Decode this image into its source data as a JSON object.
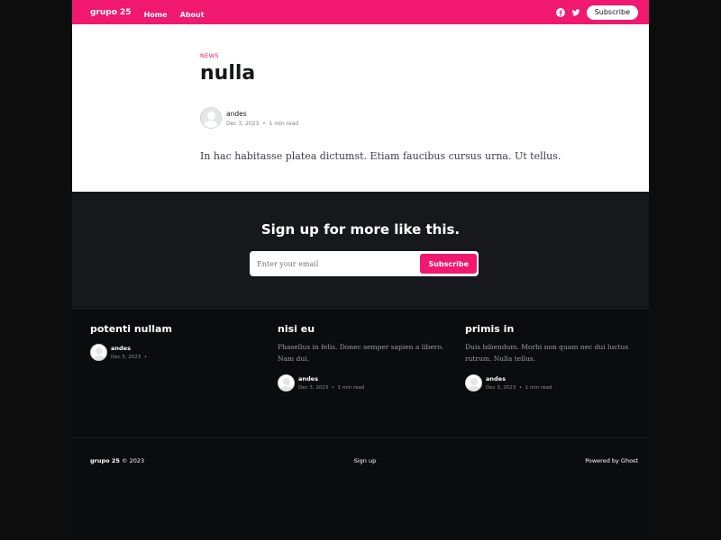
{
  "header": {
    "brand": "grupo 25",
    "nav": [
      "Home",
      "About"
    ],
    "subscribe_label": "Subscribe",
    "social_icons": [
      "facebook-icon",
      "twitter-icon"
    ],
    "accent_color": "#f0186f"
  },
  "article": {
    "tag": "NEWS",
    "title": "nulla",
    "author": "andes",
    "date": "Dec 3, 2023",
    "read_time": "1 min read",
    "excerpt": "In hac habitasse platea dictumst. Etiam faucibus cursus urna. Ut tellus."
  },
  "cta": {
    "title": "Sign up for more like this.",
    "placeholder": "Enter your email",
    "button_label": "Subscribe"
  },
  "related": [
    {
      "title": "potenti nullam",
      "excerpt": "",
      "author": "andes",
      "date": "Dec 5, 2023",
      "read_time": ""
    },
    {
      "title": "nisi eu",
      "excerpt": "Phasellus in felis. Donec semper sapien a libero. Nam dui.",
      "author": "andes",
      "date": "Dec 3, 2023",
      "read_time": "1 min read"
    },
    {
      "title": "primis in",
      "excerpt": "Duis bibendum. Morbi non quam nec dui luctus rutrum. Nulla tellus.",
      "author": "andes",
      "date": "Dec 3, 2023",
      "read_time": "1 min read"
    }
  ],
  "footer": {
    "copyright_brand": "grupo 25",
    "copyright_text": "© 2023",
    "signup": "Sign up",
    "powered": "Powered by Ghost"
  }
}
